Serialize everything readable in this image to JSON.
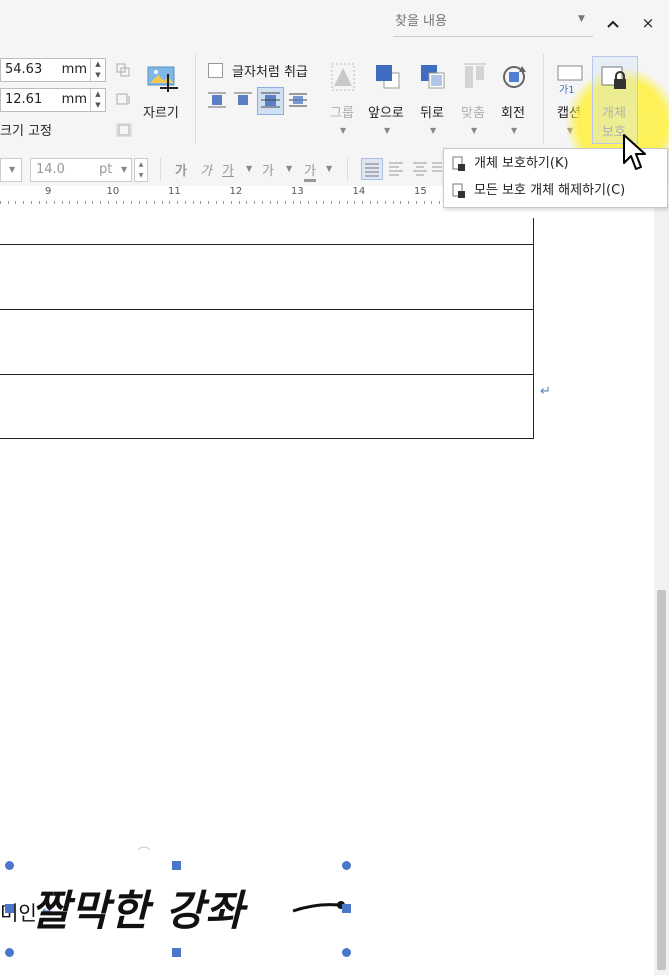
{
  "titlebar": {
    "search_placeholder": "찾을 내용",
    "collapse_icon": "chevron-up-icon",
    "close_label": "×",
    "collapse_label": "^"
  },
  "ribbon": {
    "width_value": "54.63",
    "height_value": "12.61",
    "unit": "mm",
    "size_fix_label": "크기 고정",
    "crop_label": "자르기",
    "treat_as_char_label": "글자처럼 취급",
    "group_label": "그룹",
    "front_label": "앞으로",
    "back_label": "뒤로",
    "align_label": "맞춤",
    "rotate_label": "회전",
    "caption_label": "캡션",
    "protect_label_line1": "개체",
    "protect_label_line2": "보호"
  },
  "format_row": {
    "font_size": "14.0",
    "font_unit": "pt",
    "bold_char": "가",
    "italic_char": "가",
    "underline_char": "가",
    "strike_char": "가",
    "color_char": "가"
  },
  "ruler": {
    "numbers": [
      "9",
      "10",
      "11",
      "12",
      "13",
      "14",
      "15"
    ]
  },
  "menu": {
    "items": [
      {
        "label": "개체 보호하기(K)"
      },
      {
        "label": "모든 보호 개체 해제하기(C)"
      }
    ]
  },
  "document": {
    "signature_text": "짤막한 강좌",
    "partial_text": "미인"
  },
  "colors": {
    "accent": "#4a77c9",
    "highlight": "#fff35a"
  }
}
